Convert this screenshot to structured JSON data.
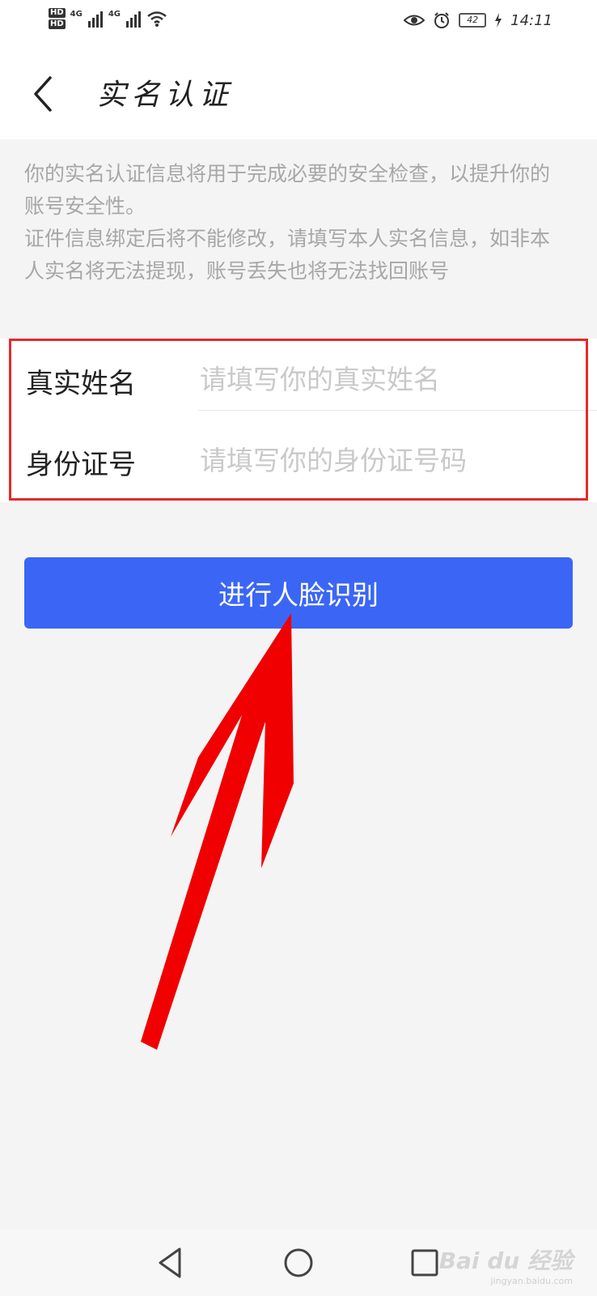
{
  "status_bar": {
    "hd1": "HD",
    "hd2": "HD",
    "network1": "4G",
    "network2": "4G",
    "battery": "42",
    "time": "14:11",
    "icons": [
      "signal-icon",
      "wifi-icon",
      "eye-icon",
      "alarm-icon",
      "battery-icon",
      "charging-icon"
    ]
  },
  "header": {
    "title": "实名认证",
    "back_icon": "chevron-left-icon"
  },
  "notice": {
    "line1": "你的实名认证信息将用于完成必要的安全检查，以提升你的账号安全性。",
    "line2": "证件信息绑定后将不能修改，请填写本人实名信息，如非本人实名将无法提现，账号丢失也将无法找回账号"
  },
  "form": {
    "name_label": "真实姓名",
    "name_placeholder": "请填写你的真实姓名",
    "name_value": "",
    "id_label": "身份证号",
    "id_placeholder": "请填写你的身份证号码",
    "id_value": "",
    "highlight_color": "#e7292c"
  },
  "primary_button": {
    "label": "进行人脸识别",
    "color": "#3b66f5"
  },
  "annotation": {
    "arrow_color": "#f00000"
  },
  "nav_bar": {
    "icons": [
      "nav-back-icon",
      "nav-home-icon",
      "nav-recent-icon"
    ]
  },
  "watermark": {
    "text": "Bai du 经验",
    "subtext": "jingyan.baidu.com"
  }
}
